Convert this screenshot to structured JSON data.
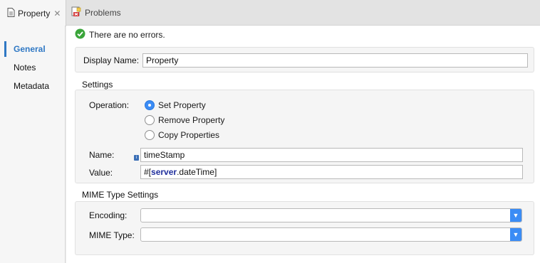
{
  "tabs": [
    {
      "label": "Property",
      "icon": "property-file-icon",
      "active": true
    },
    {
      "label": "Problems",
      "icon": "problems-icon",
      "active": false
    }
  ],
  "sidebar": {
    "items": [
      {
        "label": "General",
        "active": true
      },
      {
        "label": "Notes",
        "active": false
      },
      {
        "label": "Metadata",
        "active": false
      }
    ]
  },
  "status": {
    "text": "There are no errors.",
    "icon": "check-circle-icon"
  },
  "display_name": {
    "label": "Display Name:",
    "value": "Property"
  },
  "settings": {
    "title": "Settings",
    "operation_label": "Operation:",
    "options": [
      {
        "label": "Set Property",
        "checked": true
      },
      {
        "label": "Remove Property",
        "checked": false
      },
      {
        "label": "Copy Properties",
        "checked": false
      }
    ],
    "name": {
      "label": "Name:",
      "value": "timeStamp"
    },
    "value": {
      "label": "Value:",
      "prefix": "#[",
      "key": "server",
      "suffix": ".dateTime]"
    }
  },
  "mime": {
    "title": "MIME Type Settings",
    "encoding": {
      "label": "Encoding:",
      "value": ""
    },
    "mime_type": {
      "label": "MIME Type:",
      "value": ""
    }
  },
  "colors": {
    "accent": "#2f78c4",
    "radio_checked": "#3b8cf5",
    "success": "#3aa53a"
  }
}
